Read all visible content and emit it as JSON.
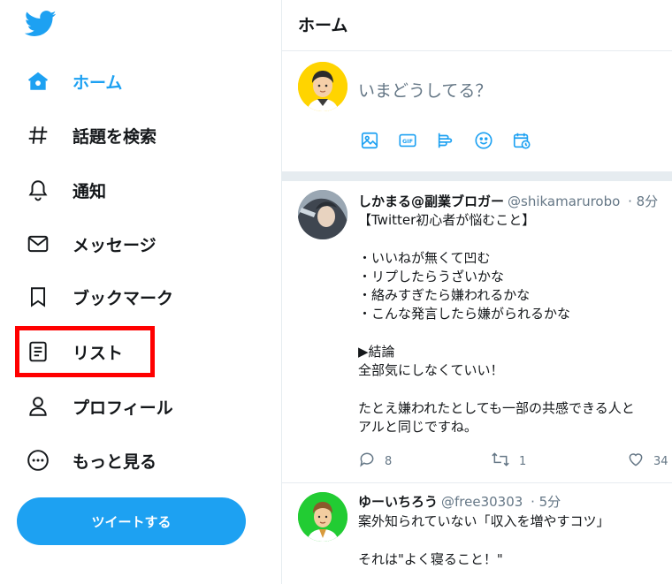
{
  "sidebar": {
    "nav": [
      {
        "label": "ホーム",
        "icon": "home-icon"
      },
      {
        "label": "話題を検索",
        "icon": "hashtag-icon"
      },
      {
        "label": "通知",
        "icon": "bell-icon"
      },
      {
        "label": "メッセージ",
        "icon": "mail-icon"
      },
      {
        "label": "ブックマーク",
        "icon": "bookmark-icon"
      },
      {
        "label": "リスト",
        "icon": "list-icon"
      },
      {
        "label": "プロフィール",
        "icon": "person-icon"
      },
      {
        "label": "もっと見る",
        "icon": "more-icon"
      }
    ],
    "tweet_button": "ツイートする"
  },
  "main": {
    "title": "ホーム",
    "compose_placeholder": "いまどうしてる？",
    "compose_tools": [
      "image-icon",
      "gif-icon",
      "poll-icon",
      "emoji-icon",
      "schedule-icon"
    ]
  },
  "tweets": [
    {
      "name": "しかまる@副業ブロガー",
      "handle": "@shikamarurobo",
      "time": "· 8分",
      "body": "【Twitter初心者が悩むこと】\n\n・いいねが無くて凹む\n・リプしたらうざいかな\n・絡みすぎたら嫌われるかな\n・こんな発言したら嫌がられるかな\n\n▶結論\n全部気にしなくていい！\n\nたとえ嫌われたとしても一部の共感できる人と\nアルと同じですね。",
      "replies": "8",
      "retweets": "1",
      "likes": "34"
    },
    {
      "name": "ゆーいちろう",
      "handle": "@free30303",
      "time": "· 5分",
      "body": "案外知られていない「収入を増やすコツ」\n\nそれは\"よく寝ること！\""
    }
  ],
  "colors": {
    "accent": "#1da1f2",
    "highlight": "#ff0000",
    "divider": "#e6ecf0"
  }
}
